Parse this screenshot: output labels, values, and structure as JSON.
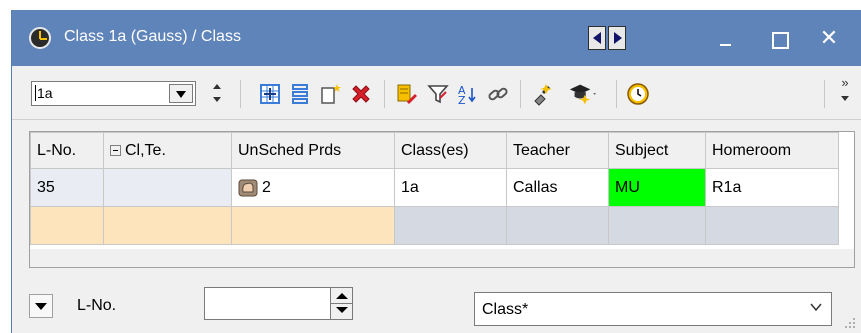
{
  "window": {
    "title": "Class 1a (Gauss) / Class",
    "title_bg": "#5f84ba"
  },
  "toolbar": {
    "element_combo_value": "1a",
    "overflow_glyph": "»",
    "icons": [
      "grid-settings-icon",
      "list-icon",
      "new-icon",
      "delete-icon",
      "edit-icon",
      "filter-icon",
      "sort-icon",
      "link-icon",
      "plugin-icon",
      "teacher-hat-icon",
      "clock-icon"
    ]
  },
  "table": {
    "columns": [
      "L-No.",
      "Cl,Te.",
      "UnSched Prds",
      "Class(es)",
      "Teacher",
      "Subject",
      "Homeroom"
    ],
    "rows": [
      {
        "lno": "35",
        "clte": "",
        "unsched": "2",
        "classes": "1a",
        "teacher": "Callas",
        "subject": "MU",
        "homeroom": "R1a"
      }
    ],
    "subject_color": "#00ff00",
    "new_row_color": "#fde4bd"
  },
  "filter": {
    "field_label": "L-No.",
    "value": "",
    "class_select_value": "Class*"
  }
}
